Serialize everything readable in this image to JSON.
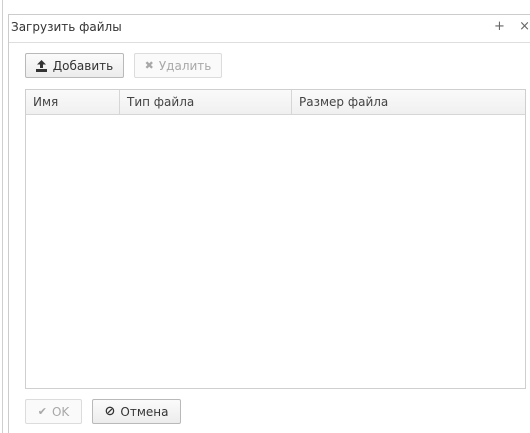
{
  "dialog": {
    "title": "Загрузить файлы",
    "title_actions": {
      "add": "+",
      "close": "×"
    }
  },
  "toolbar": {
    "add_label": "Добавить",
    "delete_label": "Удалить",
    "delete_icon": "✖",
    "add_icon_name": "upload-icon",
    "delete_icon_name": "x-icon"
  },
  "table": {
    "columns": [
      "Имя",
      "Тип файла",
      "Размер файла"
    ],
    "rows": []
  },
  "footer": {
    "ok_label": "OK",
    "ok_icon": "✔",
    "cancel_label": "Отмена",
    "cancel_icon": "⊘"
  }
}
